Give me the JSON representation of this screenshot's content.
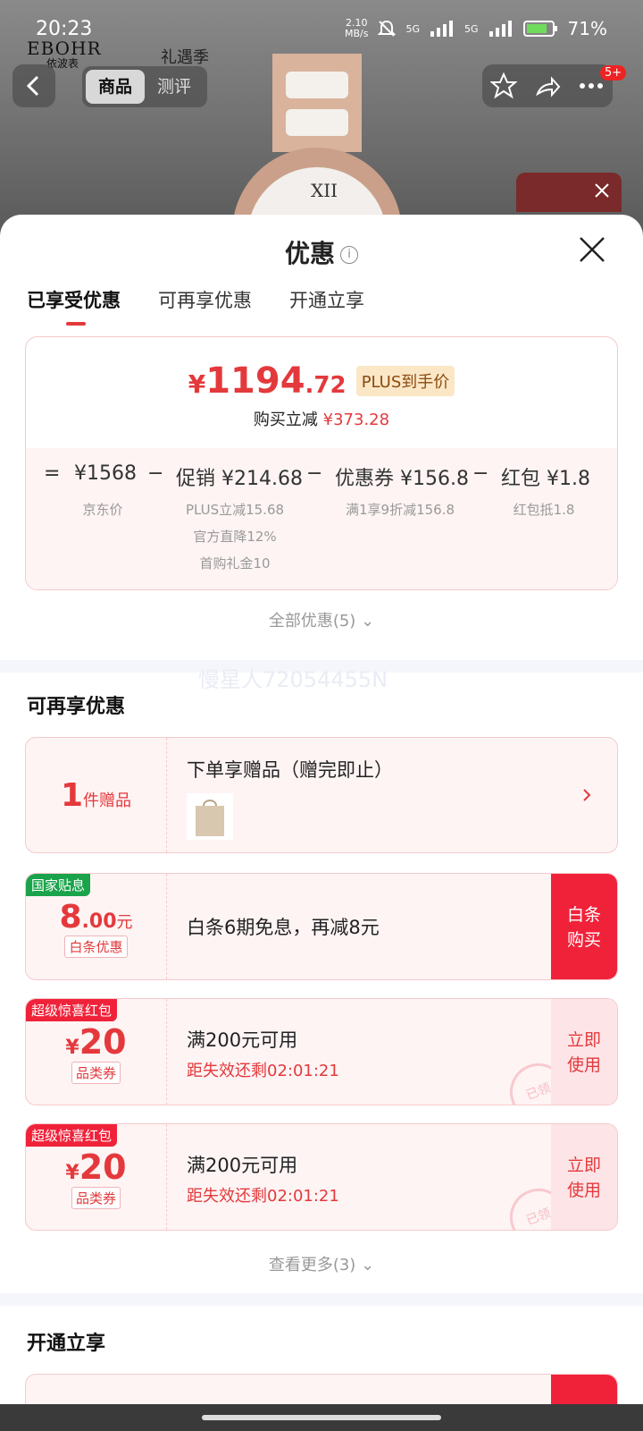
{
  "status": {
    "time": "20:23",
    "speed_top": "2.10",
    "speed_bot": "MB/s",
    "net1": "5G",
    "net2": "5G",
    "battery": "71%"
  },
  "brand": {
    "name": "EBOHR",
    "sub": "依波表",
    "campaign": "礼遇季"
  },
  "nav": {
    "tab_goods": "商品",
    "tab_review": "测评",
    "badge": "5+"
  },
  "sheet": {
    "title": "优惠",
    "info": "i"
  },
  "tabs": [
    "已享受优惠",
    "可再享优惠",
    "开通立享"
  ],
  "summary": {
    "price_yen": "¥",
    "price_int": "1194",
    "price_dec": ".72",
    "plus_label": "PLUS到手价",
    "saved_label": "购买立减",
    "saved_value": "¥373.28",
    "eq": "=",
    "jd_price": "¥1568",
    "jd_label": "京东价",
    "minus": "−",
    "promo_name": "促销",
    "promo_value": "¥214.68",
    "promo_sub": [
      "PLUS立减15.68",
      "官方直降12%",
      "首购礼金10"
    ],
    "coupon_name": "优惠券",
    "coupon_value": "¥156.8",
    "coupon_sub": "满1享9折减156.8",
    "hb_name": "红包",
    "hb_value": "¥1.8",
    "hb_sub": "红包抵1.8"
  },
  "all_more": "全部优惠(5)",
  "watermark": "慢星人72054455N",
  "more_section": {
    "title": "可再享优惠"
  },
  "gift": {
    "num": "1",
    "unit": "件赠品",
    "title": "下单享赠品（赠完即止）"
  },
  "baitiao": {
    "tag": "国家贴息",
    "amount_int": "8",
    "amount_dec": ".00",
    "amount_unit": "元",
    "label": "白条优惠",
    "desc": "白条6期免息，再减8元",
    "btn1": "白条",
    "btn2": "购买"
  },
  "coupons": [
    {
      "tag": "超级惊喜红包",
      "yen": "¥",
      "amount": "20",
      "label": "品类券",
      "desc": "满200元可用",
      "countdown": "距失效还剩02:01:21",
      "btn1": "立即",
      "btn2": "使用",
      "stamp": "已领"
    },
    {
      "tag": "超级惊喜红包",
      "yen": "¥",
      "amount": "20",
      "label": "品类券",
      "desc": "满200元可用",
      "countdown": "距失效还剩02:01:21",
      "btn1": "立即",
      "btn2": "使用",
      "stamp": "已领"
    }
  ],
  "see_more": "查看更多(3)",
  "open_section": {
    "title": "开通立享"
  },
  "colors": {
    "accent": "#e4393c",
    "button_red": "#f0223a",
    "tag_green": "#1aa34a"
  }
}
